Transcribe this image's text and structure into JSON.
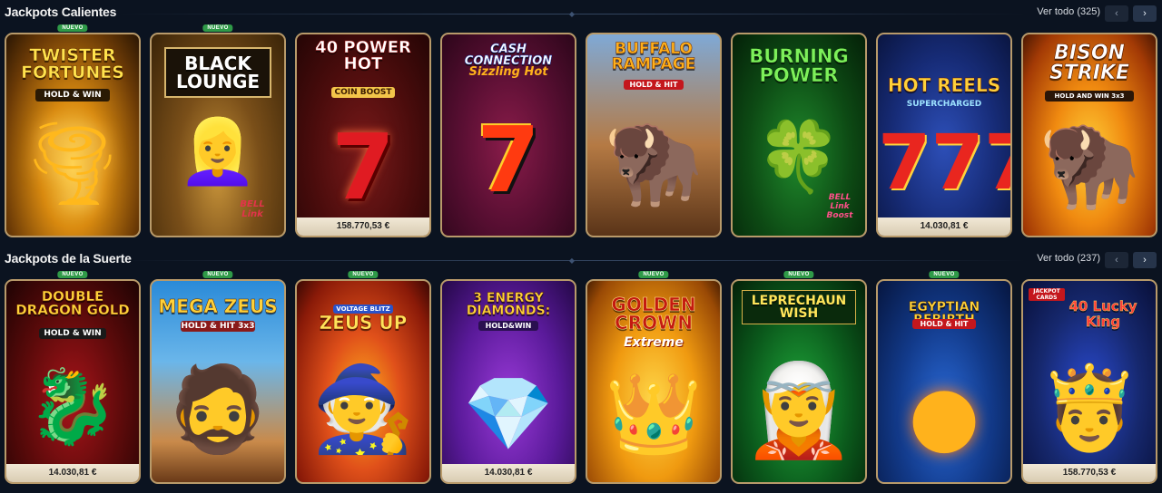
{
  "sections": [
    {
      "title": "Jackpots Calientes",
      "ver_todo": "Ver todo (325)",
      "prev_icon": "‹",
      "next_icon": "›",
      "games": [
        {
          "name": "TWISTER FORTUNES",
          "subtitle": "HOLD & WIN",
          "badge": "NUEVO",
          "amount": ""
        },
        {
          "name": "BLACK LOUNGE",
          "subtitle": "BELL Link",
          "badge": "NUEVO",
          "amount": ""
        },
        {
          "name": "40 POWER HOT",
          "subtitle": "COIN BOOST",
          "badge": "",
          "amount": "158.770,53 €"
        },
        {
          "name": "CASH CONNECTION",
          "subtitle": "Sizzling Hot",
          "badge": "",
          "amount": ""
        },
        {
          "name": "BUFFALO RAMPAGE",
          "subtitle": "HOLD & HIT",
          "badge": "",
          "amount": ""
        },
        {
          "name": "BURNING POWER",
          "subtitle": "BELL Link Boost",
          "badge": "",
          "amount": ""
        },
        {
          "name": "HOT REELS",
          "subtitle": "SUPERCHARGED",
          "badge": "",
          "amount": "14.030,81 €"
        },
        {
          "name": "BISON STRIKE",
          "subtitle": "HOLD AND WIN 3x3",
          "badge": "",
          "amount": ""
        }
      ]
    },
    {
      "title": "Jackpots de la Suerte",
      "ver_todo": "Ver todo (237)",
      "prev_icon": "‹",
      "next_icon": "›",
      "games": [
        {
          "name": "DOUBLE DRAGON GOLD",
          "subtitle": "HOLD & WIN",
          "badge": "NUEVO",
          "amount": "14.030,81 €"
        },
        {
          "name": "MEGA ZEUS",
          "subtitle": "HOLD & HIT 3x3",
          "badge": "NUEVO",
          "amount": ""
        },
        {
          "name": "ZEUS UP",
          "subtitle": "VOLTAGE BLITZ",
          "badge": "NUEVO",
          "amount": ""
        },
        {
          "name": "3 ENERGY DIAMONDS:",
          "subtitle": "HOLD&WIN",
          "badge": "",
          "amount": "14.030,81 €"
        },
        {
          "name": "GOLDEN CROWN",
          "subtitle": "Extreme",
          "badge": "NUEVO",
          "amount": ""
        },
        {
          "name": "LEPRECHAUN WISH",
          "subtitle": "",
          "badge": "NUEVO",
          "amount": ""
        },
        {
          "name": "EGYPTIAN REBIRTH",
          "subtitle": "HOLD & HIT",
          "badge": "NUEVO",
          "amount": ""
        },
        {
          "name": "40 Lucky King",
          "subtitle": "JACKPOT CARDS",
          "badge": "",
          "amount": "158.770,53 €"
        }
      ]
    }
  ],
  "colors": {
    "background": "#0b1320",
    "badge": "#2f9a48",
    "card_border": "#b89a6a",
    "amount_bar": "#e8dcc4"
  }
}
